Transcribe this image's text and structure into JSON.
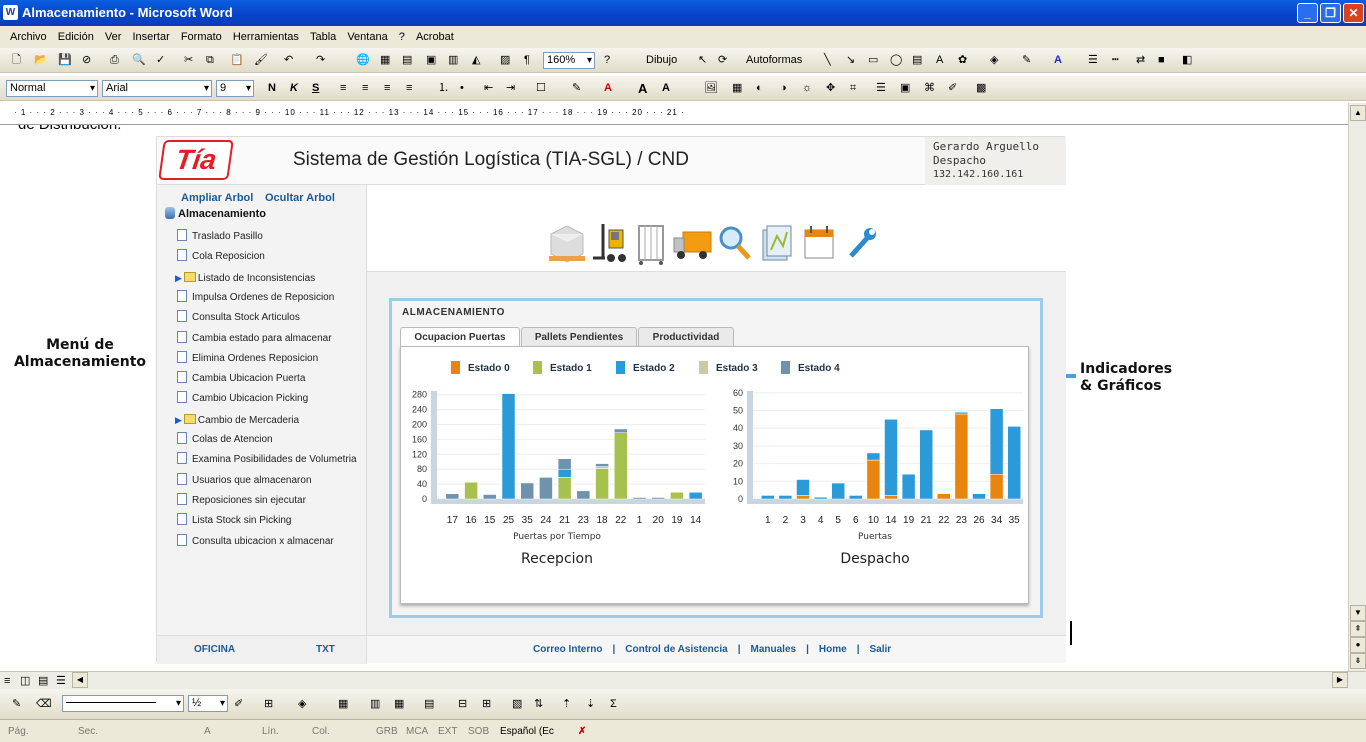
{
  "window": {
    "title": "Almacenamiento - Microsoft Word"
  },
  "menu": [
    "Archivo",
    "Edición",
    "Ver",
    "Insertar",
    "Formato",
    "Herramientas",
    "Tabla",
    "Ventana",
    "?",
    "Acrobat"
  ],
  "toolbar1": {
    "zoom": "160%",
    "dibujo": "Dibujo",
    "autoformas": "Autoformas"
  },
  "toolbar2": {
    "style": "Normal",
    "font": "Arial",
    "size": "9",
    "bold": "N",
    "italic": "K",
    "underline": "S"
  },
  "ruler": "· 1 · · · 2 · · · 3 · · · 4 · · · 5 · · · 6 · · · 7 · · · 8 · · · 9 · · · 10 · · · 11 · · · 12 · · · 13 · · · 14 · · · 15 · · · 16 · · · 17 · · · 18 · · · 19 · · · 20 · · · 21 ·",
  "doc_fragment": "de Distribución.",
  "annotations": {
    "menu_l1": "Menú de",
    "menu_l2": "Almacenamiento",
    "ind_l1": "Indicadores",
    "ind_l2": "& Gráficos"
  },
  "app": {
    "logo": "Tía",
    "title": "Sistema de Gestión Logística (TIA-SGL) / CND",
    "user": {
      "name": "Gerardo Arguello",
      "role": "Despacho",
      "ip": "132.142.160.161"
    },
    "sidebar": {
      "expand": "Ampliar Arbol",
      "hide": "Ocultar Arbol",
      "root": "Almacenamiento",
      "items": [
        {
          "label": "Traslado Pasillo",
          "type": "doc"
        },
        {
          "label": "Cola Reposicion",
          "type": "doc"
        },
        {
          "label": "Listado de Inconsistencias",
          "type": "folder"
        },
        {
          "label": "Impulsa Ordenes de Reposicion",
          "type": "doc"
        },
        {
          "label": "Consulta Stock Articulos",
          "type": "doc"
        },
        {
          "label": "Cambia estado para almacenar",
          "type": "doc"
        },
        {
          "label": "Elimina Ordenes Reposicion",
          "type": "doc"
        },
        {
          "label": "Cambia Ubicacion Puerta",
          "type": "doc"
        },
        {
          "label": "Cambio Ubicacion Picking",
          "type": "doc"
        },
        {
          "label": "Cambio de Mercaderia",
          "type": "folder"
        },
        {
          "label": "Colas de Atencion",
          "type": "doc"
        },
        {
          "label": "Examina Posibilidades de Volumetria",
          "type": "doc"
        },
        {
          "label": "Usuarios que almacenaron",
          "type": "doc"
        },
        {
          "label": "Reposiciones sin ejecutar",
          "type": "doc"
        },
        {
          "label": "Lista Stock sin Picking",
          "type": "doc"
        },
        {
          "label": "Consulta ubicacion x almacenar",
          "type": "doc"
        }
      ]
    },
    "panel_title": "ALMACENAMIENTO",
    "tabs": [
      "Ocupacion Puertas",
      "Pallets Pendientes",
      "Productividad"
    ],
    "footer_left": [
      "OFICINA",
      "TXT"
    ],
    "footer_links": [
      "Correo Interno",
      "Control de Asistencia",
      "Manuales",
      "Home",
      "Salir"
    ]
  },
  "colors": {
    "Estado 0": "#e8850e",
    "Estado 1": "#a7c14f",
    "Estado 2": "#2b9ad8",
    "Estado 3": "#cfc9a3",
    "Estado 4": "#6f93ad"
  },
  "chart_data": [
    {
      "type": "bar",
      "stacked": true,
      "title": "Recepcion",
      "xlabel": "Puertas por Tiempo",
      "ylabel": "",
      "ylim": [
        0,
        290
      ],
      "yticks": [
        0,
        40,
        80,
        120,
        160,
        200,
        240,
        280
      ],
      "legend": [
        "Estado 0",
        "Estado 1",
        "Estado 2",
        "Estado 3",
        "Estado 4"
      ],
      "categories": [
        "17",
        "16",
        "15",
        "25",
        "35",
        "24",
        "21",
        "23",
        "18",
        "22",
        "1",
        "20",
        "19",
        "14"
      ],
      "series": [
        {
          "name": "Estado 0",
          "values": [
            0,
            0,
            0,
            0,
            0,
            0,
            0,
            0,
            0,
            0,
            0,
            0,
            0,
            0
          ]
        },
        {
          "name": "Estado 1",
          "values": [
            0,
            45,
            0,
            0,
            0,
            0,
            58,
            0,
            82,
            178,
            0,
            0,
            18,
            0
          ]
        },
        {
          "name": "Estado 2",
          "values": [
            0,
            0,
            0,
            283,
            0,
            0,
            22,
            0,
            0,
            0,
            0,
            0,
            0,
            18
          ]
        },
        {
          "name": "Estado 3",
          "values": [
            0,
            0,
            0,
            0,
            0,
            0,
            0,
            0,
            5,
            0,
            0,
            0,
            0,
            0
          ]
        },
        {
          "name": "Estado 4",
          "values": [
            14,
            0,
            12,
            0,
            43,
            58,
            28,
            22,
            8,
            10,
            4,
            4,
            0,
            0
          ]
        }
      ]
    },
    {
      "type": "bar",
      "stacked": true,
      "title": "Despacho",
      "xlabel": "Puertas",
      "ylabel": "",
      "ylim": [
        0,
        61
      ],
      "yticks": [
        0,
        10,
        20,
        30,
        40,
        50,
        60
      ],
      "legend": [
        "Estado 0",
        "Estado 1",
        "Estado 2",
        "Estado 3",
        "Estado 4"
      ],
      "categories": [
        "1",
        "2",
        "3",
        "4",
        "5",
        "6",
        "10",
        "14",
        "19",
        "21",
        "22",
        "23",
        "26",
        "34",
        "35"
      ],
      "series": [
        {
          "name": "Estado 0",
          "values": [
            0,
            0,
            2,
            0,
            0,
            0,
            22,
            2,
            0,
            0,
            3,
            48,
            0,
            14,
            0
          ]
        },
        {
          "name": "Estado 1",
          "values": [
            0,
            0,
            0,
            0,
            0,
            0,
            0,
            0,
            0,
            0,
            0,
            0,
            0,
            0,
            0
          ]
        },
        {
          "name": "Estado 2",
          "values": [
            2,
            2,
            9,
            1,
            9,
            2,
            4,
            43,
            14,
            39,
            0,
            1,
            3,
            37,
            41
          ]
        },
        {
          "name": "Estado 3",
          "values": [
            0,
            0,
            0,
            0,
            0,
            0,
            0,
            0,
            0,
            0,
            0,
            0,
            0,
            0,
            0
          ]
        },
        {
          "name": "Estado 4",
          "values": [
            0,
            0,
            0,
            0,
            0,
            0,
            0,
            0,
            0,
            0,
            0,
            0,
            0,
            0,
            0
          ]
        }
      ]
    }
  ],
  "status": {
    "pag": "Pág.",
    "sec": "Sec.",
    "a": "A",
    "lin": "Lín.",
    "col": "Col.",
    "grb": "GRB",
    "mca": "MCA",
    "ext": "EXT",
    "sob": "SOB",
    "lang": "Español (Ec"
  }
}
